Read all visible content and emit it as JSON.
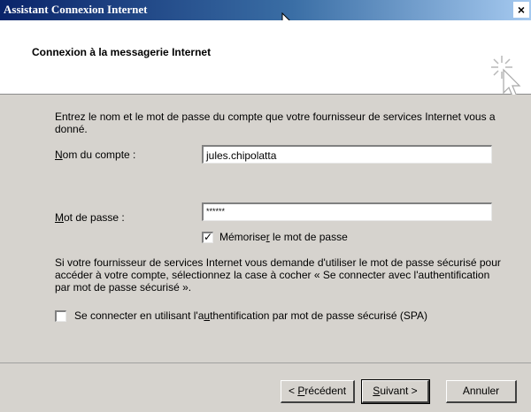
{
  "window": {
    "title": "Assistant Connexion Internet",
    "close_glyph": "×"
  },
  "header": {
    "heading": "Connexion à la messagerie Internet"
  },
  "form": {
    "description": "Entrez le nom et le mot de passe du compte que votre fournisseur de services Internet vous a donné.",
    "account": {
      "label_ul": "N",
      "label_rest": "om du compte :",
      "value": "jules.chipolatta"
    },
    "password": {
      "label_ul": "M",
      "label_rest": "ot de passe :",
      "value": "******"
    },
    "remember": {
      "checked": true,
      "check_glyph": "✓",
      "label_pre": "Mémorise",
      "label_ul": "r",
      "label_post": " le mot de passe"
    },
    "spa_text": "Si votre fournisseur de services Internet vous demande d'utiliser le mot de passe sécurisé pour accéder à votre compte, sélectionnez la case à cocher « Se connecter avec l'authentification par mot de passe sécurisé ».",
    "spa": {
      "checked": false,
      "label_pre": "Se connecter en utilisant l'a",
      "label_ul": "u",
      "label_post": "thentification par mot de passe sécurisé (SPA)"
    }
  },
  "buttons": {
    "back": {
      "pre": "< ",
      "ul": "P",
      "post": "récédent"
    },
    "next": {
      "pre": "",
      "ul": "S",
      "post": "uivant >"
    },
    "cancel": "Annuler"
  }
}
